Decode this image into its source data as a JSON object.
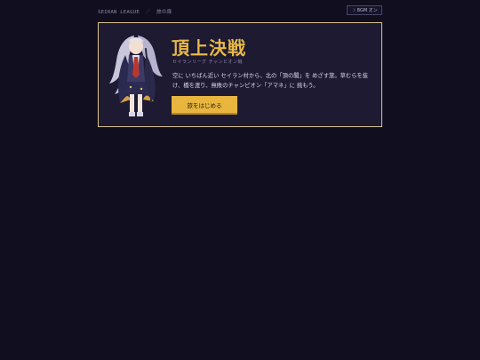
{
  "breadcrumb": {
    "league": "SEIRAN LEAGUE",
    "separator": "／",
    "current": "旅の扉"
  },
  "bgm_toggle": {
    "icon": "moon-icon",
    "label": "BGM オン"
  },
  "hero": {
    "title": "頂上決戦",
    "subtitle": "セイランリーグ チャンピオン戦",
    "description": "空に いちばん近い セイラン村から、北の「頂の閣」を めざす旅。草むらを抜け、橋を渡り、無敗のチャンピオン「アマネ」に 挑もう。",
    "cta_label": "旅をはじめる",
    "portrait": "champion-character-illustration"
  },
  "colors": {
    "background": "#100e1f",
    "card": "#1d1a32",
    "accent": "#e8b948",
    "border": "#d8c28a",
    "button": "#e8b53f"
  }
}
